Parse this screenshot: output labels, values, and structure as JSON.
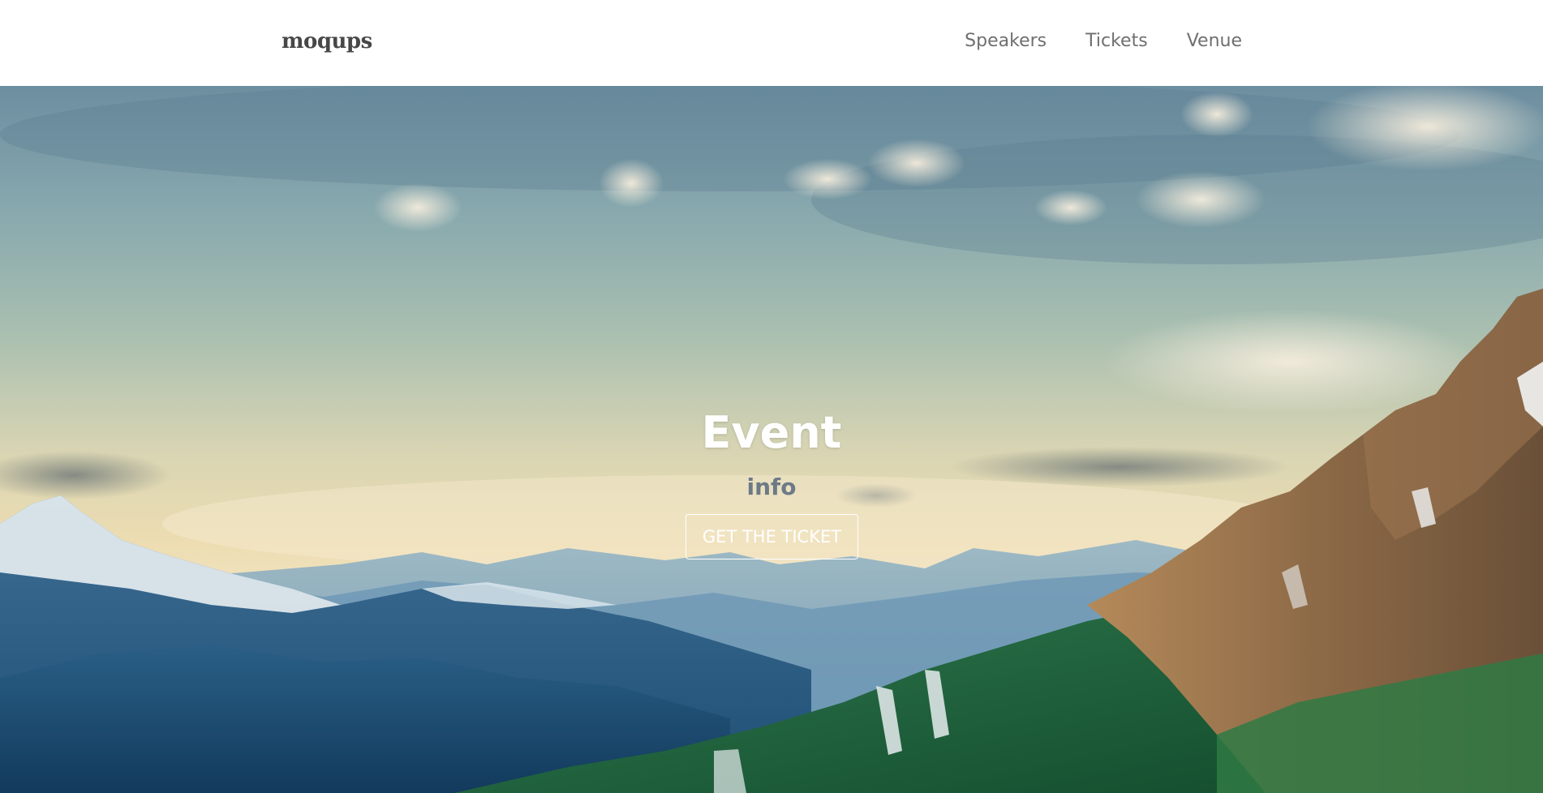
{
  "navbar": {
    "brand": "moqups",
    "links": [
      {
        "label": "Speakers"
      },
      {
        "label": "Tickets"
      },
      {
        "label": "Venue"
      }
    ]
  },
  "hero": {
    "title": "Event",
    "subtitle": "info",
    "button_label": "GET THE TICKET",
    "background_image": "mountain-landscape"
  },
  "colors": {
    "brand_text": "#474747",
    "nav_text": "#6f6f6f",
    "title_text": "#ffffff",
    "subtitle_text": "#6d7a86",
    "button_border": "#ffffff"
  }
}
